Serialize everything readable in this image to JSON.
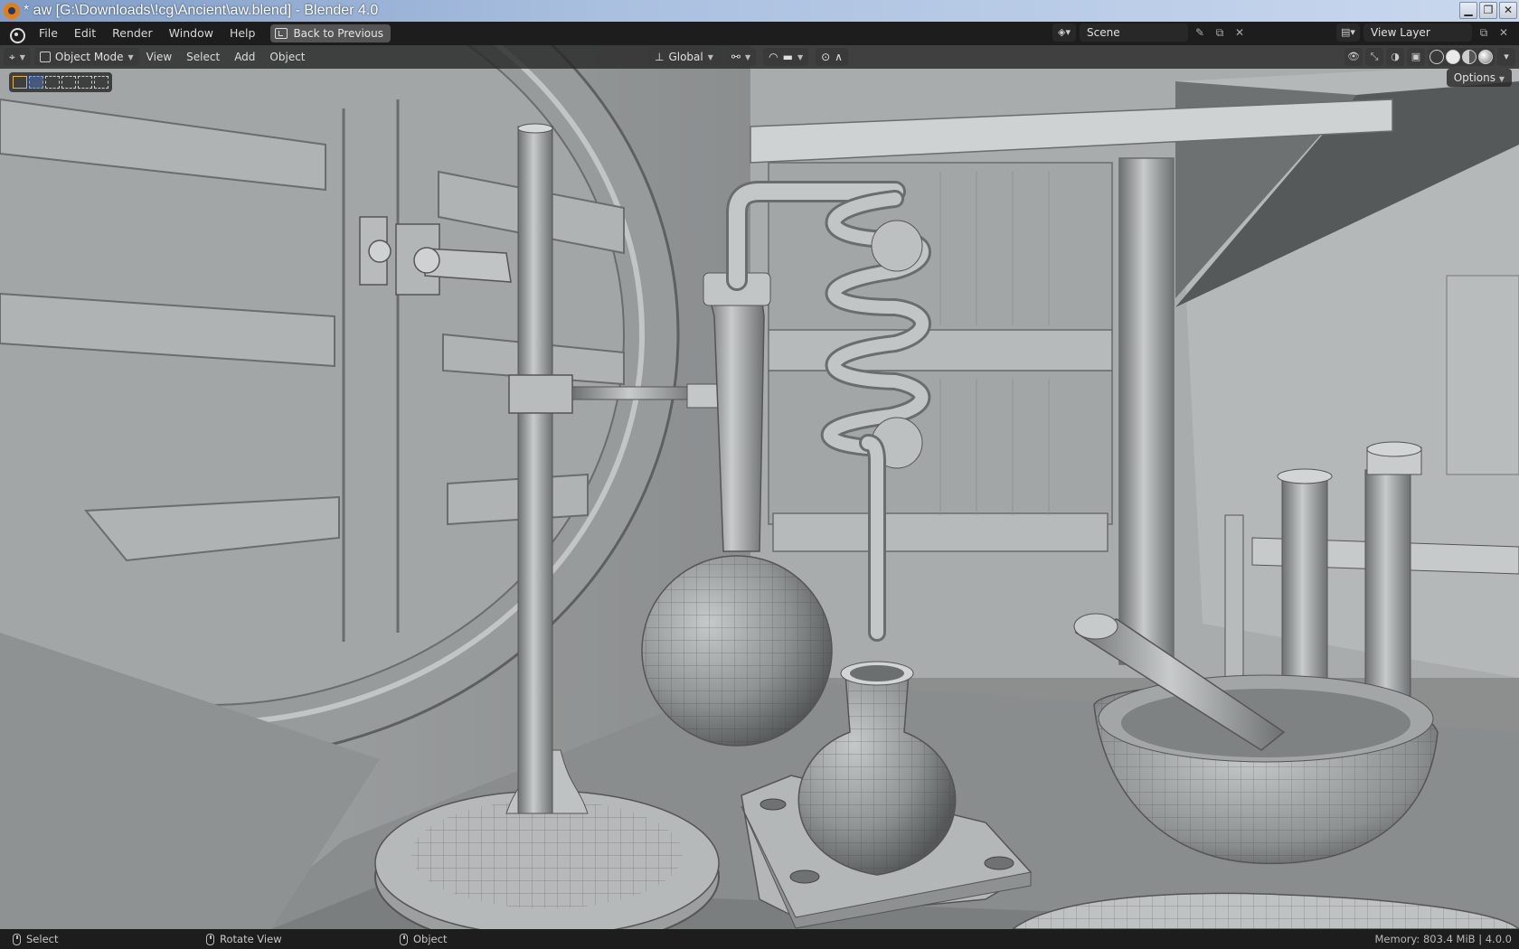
{
  "window": {
    "title": "* aw [G:\\Downloads\\!cg\\Ancient\\aw.blend] - Blender 4.0",
    "buttons": {
      "minimize": "▁",
      "restore": "❐",
      "close": "✕"
    }
  },
  "topbar": {
    "menus": [
      "File",
      "Edit",
      "Render",
      "Window",
      "Help"
    ],
    "back_button": "Back to Previous",
    "scene": "Scene",
    "view_layer": "View Layer"
  },
  "viewport_header": {
    "mode": "Object Mode",
    "menus": [
      "View",
      "Select",
      "Add",
      "Object"
    ],
    "orientation": "Global",
    "options": "Options"
  },
  "statusbar": {
    "left_click": "Select",
    "middle_click": "Rotate View",
    "right_click": "Object",
    "memory": "Memory: 803.4 MiB | 4.0.0"
  },
  "colors": {
    "accent": "#4772b3",
    "header_bg": "#1d1d1d",
    "viewport_bg": "#8d8f8f"
  },
  "icons": {
    "app": "blender-logo-icon",
    "back": "back-to-previous-icon",
    "mode": "object-mode-icon",
    "shading": [
      "wireframe-icon",
      "solid-icon",
      "material-icon",
      "rendered-icon"
    ]
  }
}
